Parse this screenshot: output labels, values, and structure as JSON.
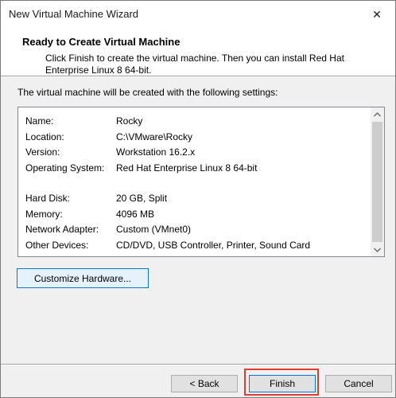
{
  "window": {
    "title": "New Virtual Machine Wizard",
    "close_glyph": "✕"
  },
  "header": {
    "title": "Ready to Create Virtual Machine",
    "subtitle": "Click Finish to create the virtual machine. Then you can install Red Hat Enterprise Linux 8 64-bit."
  },
  "intro": "The virtual machine will be created with the following settings:",
  "settings": [
    {
      "key": "Name:",
      "value": "Rocky"
    },
    {
      "key": "Location:",
      "value": "C:\\VMware\\Rocky"
    },
    {
      "key": "Version:",
      "value": "Workstation 16.2.x"
    },
    {
      "key": "Operating System:",
      "value": "Red Hat Enterprise Linux 8 64-bit"
    },
    {
      "key": "Hard Disk:",
      "value": "20 GB, Split"
    },
    {
      "key": "Memory:",
      "value": "4096 MB"
    },
    {
      "key": "Network Adapter:",
      "value": "Custom (VMnet0)"
    },
    {
      "key": "Other Devices:",
      "value": "CD/DVD, USB Controller, Printer, Sound Card"
    }
  ],
  "buttons": {
    "customize": "Customize Hardware...",
    "back": "< Back",
    "finish": "Finish",
    "cancel": "Cancel"
  },
  "colors": {
    "highlight": "#e03c31",
    "focus": "#0078d7"
  }
}
